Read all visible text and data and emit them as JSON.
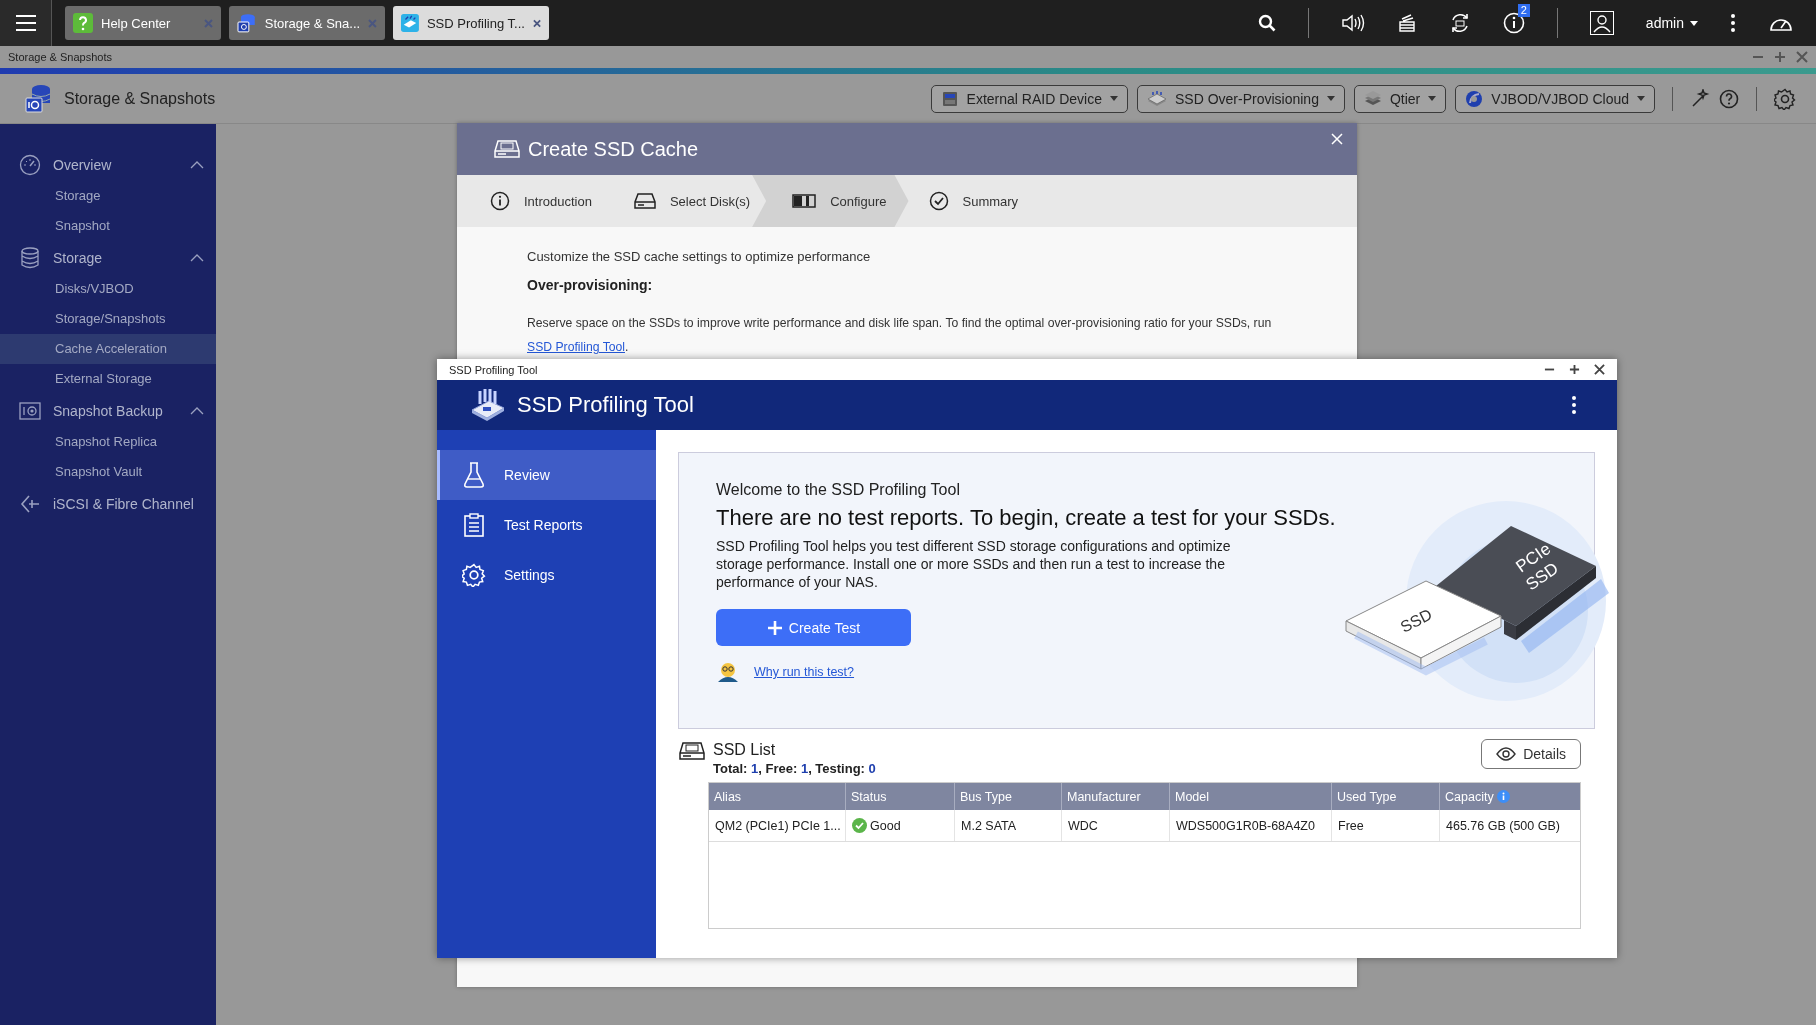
{
  "taskbar": {
    "tabs": [
      {
        "title": "Help Center",
        "selected": false
      },
      {
        "title": "Storage & Sna...",
        "selected": false
      },
      {
        "title": "SSD Profiling T...",
        "selected": true
      }
    ],
    "notification_count": "2",
    "user": "admin"
  },
  "app_window": {
    "title": "Storage & Snapshots",
    "header_title": "Storage & Snapshots",
    "toolbar": [
      "External RAID Device",
      "SSD Over-Provisioning",
      "Qtier",
      "VJBOD/VJBOD Cloud"
    ],
    "sidebar": [
      {
        "label": "Overview",
        "expanded": true,
        "children": [
          {
            "label": "Storage",
            "selected": false
          },
          {
            "label": "Snapshot",
            "selected": false
          }
        ]
      },
      {
        "label": "Storage",
        "expanded": true,
        "children": [
          {
            "label": "Disks/VJBOD",
            "selected": false
          },
          {
            "label": "Storage/Snapshots",
            "selected": false
          },
          {
            "label": "Cache Acceleration",
            "selected": true
          },
          {
            "label": "External Storage",
            "selected": false
          }
        ]
      },
      {
        "label": "Snapshot Backup",
        "expanded": true,
        "children": [
          {
            "label": "Snapshot Replica",
            "selected": false
          },
          {
            "label": "Snapshot Vault",
            "selected": false
          }
        ]
      },
      {
        "label": "iSCSI & Fibre Channel"
      }
    ]
  },
  "dialog": {
    "title": "Create SSD Cache",
    "steps": [
      {
        "label": "Introduction",
        "selected": false
      },
      {
        "label": "Select Disk(s)",
        "selected": false
      },
      {
        "label": "Configure",
        "selected": true
      },
      {
        "label": "Summary",
        "selected": false
      }
    ],
    "intro": "Customize the SSD cache settings to optimize performance",
    "section_heading": "Over-provisioning:",
    "description": "Reserve space on the SSDs to improve write performance and disk life span. To find the optimal over-provisioning ratio for your SSDs, run",
    "link": "SSD Profiling Tool",
    "link_suffix": "."
  },
  "profiling_window": {
    "window_title": "SSD Profiling Tool",
    "app_title": "SSD Profiling Tool",
    "nav": [
      {
        "label": "Review",
        "selected": true
      },
      {
        "label": "Test Reports",
        "selected": false
      },
      {
        "label": "Settings",
        "selected": false
      }
    ],
    "welcome": {
      "greeting": "Welcome to the SSD Profiling Tool",
      "headline": "There are no test reports. To begin, create a test for your SSDs.",
      "body": "SSD Profiling Tool helps you test different SSD storage configurations and optimize storage performance. Install one or more SSDs and then run a test to increase the performance of your NAS.",
      "button": "Create Test",
      "help_link": "Why run this test?",
      "illustration": {
        "card_label": [
          "PCIe",
          "SSD"
        ],
        "drive_label": "SSD"
      }
    },
    "ssd_list": {
      "title": "SSD List",
      "summary": [
        {
          "text": "Total: ",
          "kind": "label"
        },
        {
          "text": "1",
          "kind": "count"
        },
        {
          "text": ", Free: ",
          "kind": "label"
        },
        {
          "text": "1",
          "kind": "count"
        },
        {
          "text": ", Testing: ",
          "kind": "label"
        },
        {
          "text": "0",
          "kind": "count"
        }
      ],
      "details_button": "Details",
      "columns": [
        "Alias",
        "Status",
        "Bus Type",
        "Manufacturer",
        "Model",
        "Used Type",
        "Capacity"
      ],
      "rows": [
        {
          "healthy": true,
          "cells": [
            "QM2 (PCIe1) PCIe 1...",
            "Good",
            "M.2 SATA",
            "WDC",
            "WDS500G1R0B-68A4Z0",
            "Free",
            "465.76 GB (500 GB)"
          ]
        }
      ]
    }
  }
}
